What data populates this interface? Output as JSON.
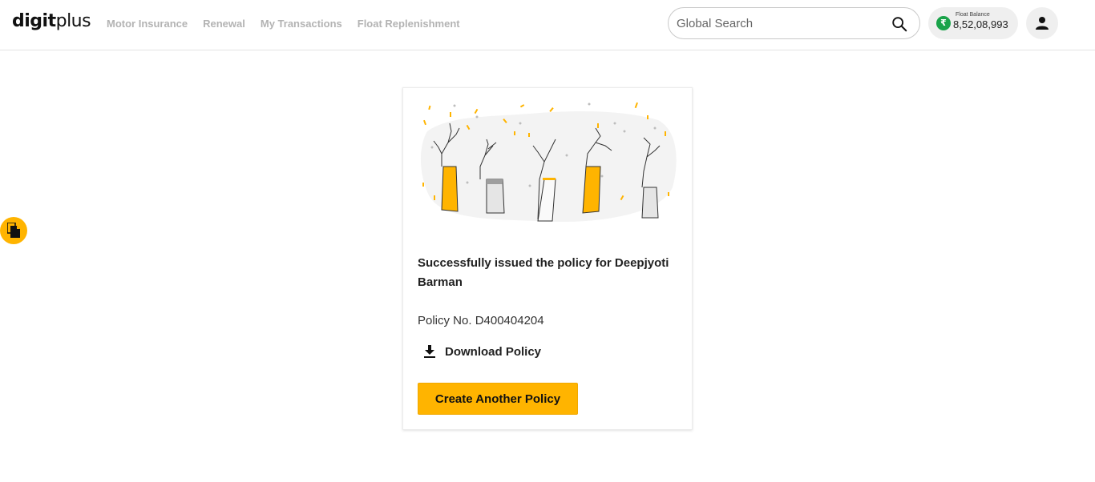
{
  "brand": {
    "logo_main": "digit",
    "logo_suffix": "plus"
  },
  "nav": {
    "items": [
      {
        "label": "Motor Insurance"
      },
      {
        "label": "Renewal"
      },
      {
        "label": "My Transactions"
      },
      {
        "label": "Float Replenishment"
      }
    ]
  },
  "search": {
    "placeholder": "Global Search",
    "icon": "search-icon"
  },
  "float_balance": {
    "label": "Float Balance",
    "value": "8,52,08,993",
    "currency_symbol": "₹"
  },
  "user": {
    "icon": "user-icon"
  },
  "side_fab": {
    "icon": "document-icon"
  },
  "card": {
    "illustration": "celebration-hands",
    "message": "Successfully issued the policy for Deepjyoti Barman",
    "policy_label": "Policy No. D400404204",
    "download_label": "Download Policy",
    "create_label": "Create Another Policy"
  },
  "colors": {
    "accent": "#ffb400",
    "rupee_badge": "#1aa34a",
    "nav_text": "#b3b3b3"
  }
}
